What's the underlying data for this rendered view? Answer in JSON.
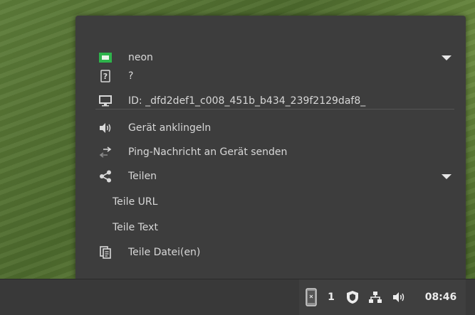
{
  "applet": {
    "device_name": "neon",
    "device_type": "?",
    "device_id": "ID: _dfd2def1_c008_451b_b434_239f2129daf8_",
    "actions": {
      "ring": "Gerät anklingeln",
      "ping": "Ping-Nachricht an Gerät senden",
      "share": "Teilen",
      "share_url": "Teile URL",
      "share_text": "Teile Text",
      "share_files": "Teile Datei(en)"
    }
  },
  "panel": {
    "device_count": "1",
    "clock": "08:46"
  },
  "colors": {
    "accent_green": "#2eb34b",
    "applet_bg": "#3d3d3d",
    "panel_bg": "#393939"
  }
}
